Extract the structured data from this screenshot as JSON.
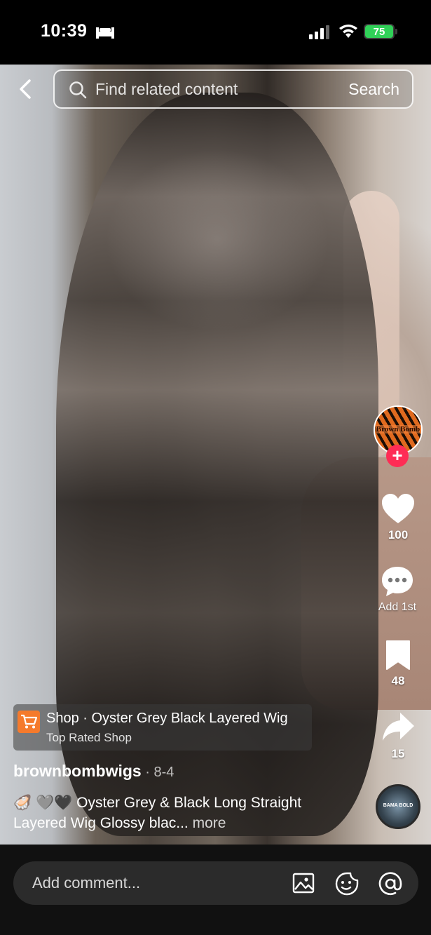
{
  "status_bar": {
    "time": "10:39",
    "battery": "75",
    "icons": [
      "bed-icon",
      "cellular-signal-icon",
      "wifi-icon",
      "battery-charging-icon"
    ]
  },
  "top_bar": {
    "back_icon": "chevron-left-icon",
    "search_placeholder": "Find related content",
    "search_button": "Search"
  },
  "right_rail": {
    "creator_avatar_text": "Brown Bomb",
    "follow_symbol": "+",
    "likes": "100",
    "comments": "Add 1st",
    "saves": "48",
    "shares": "15",
    "music_disc_text": "BAMA BOLD"
  },
  "shop": {
    "title": "Shop · Oyster Grey Black Layered Wig",
    "subtitle": "Top Rated Shop"
  },
  "post": {
    "username": "brownbombwigs",
    "date": " · 8-4",
    "caption": "🦪 🩶🖤 Oyster Grey & Black Long Straight Layered Wig Glossy blac...",
    "more": " more"
  },
  "comment_bar": {
    "placeholder": "Add comment...",
    "icons": [
      "image-icon",
      "emoji-icon",
      "mention-icon"
    ]
  },
  "colors": {
    "follow_accent": "#fe2c55",
    "shop_icon": "#f57a2c",
    "battery": "#30d158"
  }
}
